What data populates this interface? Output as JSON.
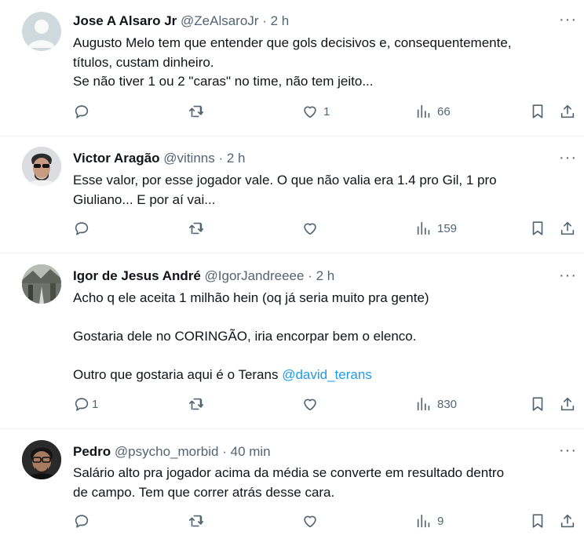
{
  "tweets": [
    {
      "name": "Jose A Alsaro Jr",
      "handle": "@ZeAlsaroJr",
      "time": "2 h",
      "lines": [
        "Augusto Melo tem que entender que gols decisivos e, consequentemente,",
        "títulos, custam dinheiro.",
        "Se não tiver 1 ou 2 \"caras\" no time, não tem jeito..."
      ],
      "replies": "",
      "retweets": "",
      "likes": "1",
      "views": "66",
      "avatar": "default-avatar"
    },
    {
      "name": "Victor Aragão",
      "handle": "@vitinns",
      "time": "2 h",
      "lines": [
        "Esse valor, por esse jogador vale. O que não valia era 1.4 pro Gil, 1 pro",
        "Giuliano... E por aí vai..."
      ],
      "replies": "",
      "retweets": "",
      "likes": "",
      "views": "159",
      "avatar": "photo-avatar"
    },
    {
      "name": "Igor de Jesus André",
      "handle": "@IgorJandreeee",
      "time": "2 h",
      "lines": [
        "Acho q ele aceita 1 milhão hein (oq já seria muito pra gente)",
        "",
        "Gostaria dele no CORINGÃO, iria encorpar bem o elenco.",
        "",
        "Outro que gostaria aqui é o Terans "
      ],
      "mention": "@david_terans",
      "replies": "1",
      "retweets": "",
      "likes": "",
      "views": "830",
      "avatar": "photo-avatar"
    },
    {
      "name": "Pedro",
      "handle": "@psycho_morbid",
      "time": "40 min",
      "lines": [
        "Salário alto pra jogador acima da média se converte em resultado dentro",
        "de campo. Tem que correr atrás desse cara."
      ],
      "replies": "",
      "retweets": "",
      "likes": "",
      "views": "9",
      "avatar": "photo-avatar"
    }
  ],
  "separator": "·",
  "more_label": "···",
  "colors": {
    "text": "#0f1419",
    "secondary": "#536471",
    "link": "#1d9bf0",
    "divider": "#eff3f4"
  }
}
